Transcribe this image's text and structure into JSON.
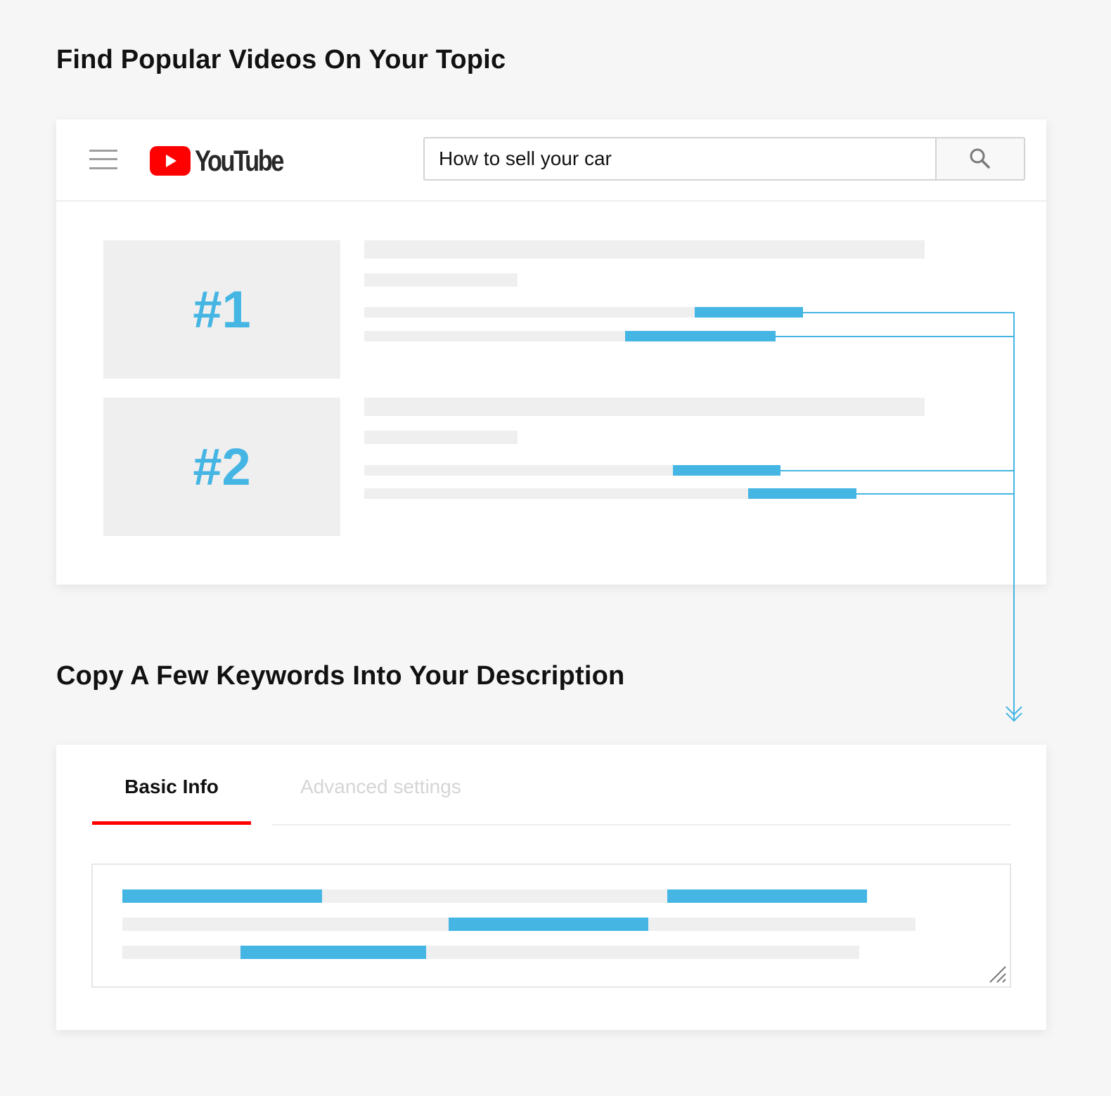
{
  "headings": {
    "step1": "Find Popular Videos On Your Topic",
    "step2": "Copy A Few Keywords Into Your Description"
  },
  "youtube": {
    "logo_text": "YouTube",
    "search_value": "How to sell your car",
    "menu_icon": "hamburger-icon",
    "search_icon": "magnifier-icon"
  },
  "results": [
    {
      "rank": "#1"
    },
    {
      "rank": "#2"
    }
  ],
  "tabs": [
    {
      "label": "Basic Info",
      "active": true
    },
    {
      "label": "Advanced settings",
      "active": false
    }
  ],
  "colors": {
    "accent": "#45b5e3",
    "youtube_red": "#ff0000",
    "tab_underline": "#ff0000",
    "placeholder_bar": "#efefef"
  }
}
